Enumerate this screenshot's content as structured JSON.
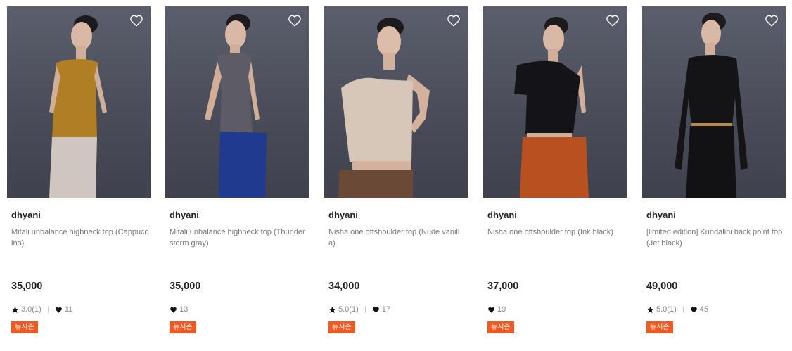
{
  "products": [
    {
      "brand": "dhyani",
      "name": "Mitali unbalance highneck top (Cappuccino)",
      "price": "35,000",
      "rating": "3.0(1)",
      "likes": "11",
      "badge": "뉴시즌",
      "colors": {
        "top": "#b07e25",
        "bottom": "#cfc7bf"
      }
    },
    {
      "brand": "dhyani",
      "name": "Mitali unbalance highneck top (Thunderstorm gray)",
      "price": "35,000",
      "rating": "",
      "likes": "13",
      "badge": "뉴시즌",
      "colors": {
        "top": "#5d5b66",
        "bottom": "#1f3a8f"
      }
    },
    {
      "brand": "dhyani",
      "name": "Nisha one offshoulder top (Nude vanilla)",
      "price": "34,000",
      "rating": "5.0(1)",
      "likes": "17",
      "badge": "뉴시즌",
      "colors": {
        "top": "#d7c7b9",
        "bottom": "#6a4a37"
      }
    },
    {
      "brand": "dhyani",
      "name": "Nisha one offshoulder top (Ink black)",
      "price": "37,000",
      "rating": "",
      "likes": "19",
      "badge": "뉴시즌",
      "colors": {
        "top": "#141418",
        "bottom": "#b8501f"
      }
    },
    {
      "brand": "dhyani",
      "name": "[limited edition] Kundalini back point top (Jet black)",
      "price": "49,000",
      "rating": "5.0(1)",
      "likes": "45",
      "badge": "뉴시즌",
      "colors": {
        "top": "#141417",
        "bottom": "#121215"
      }
    }
  ],
  "icons": {
    "wishlist": "heart-outline-icon",
    "rating": "star-icon",
    "likes": "heart-icon"
  },
  "accent": "#f05a22"
}
